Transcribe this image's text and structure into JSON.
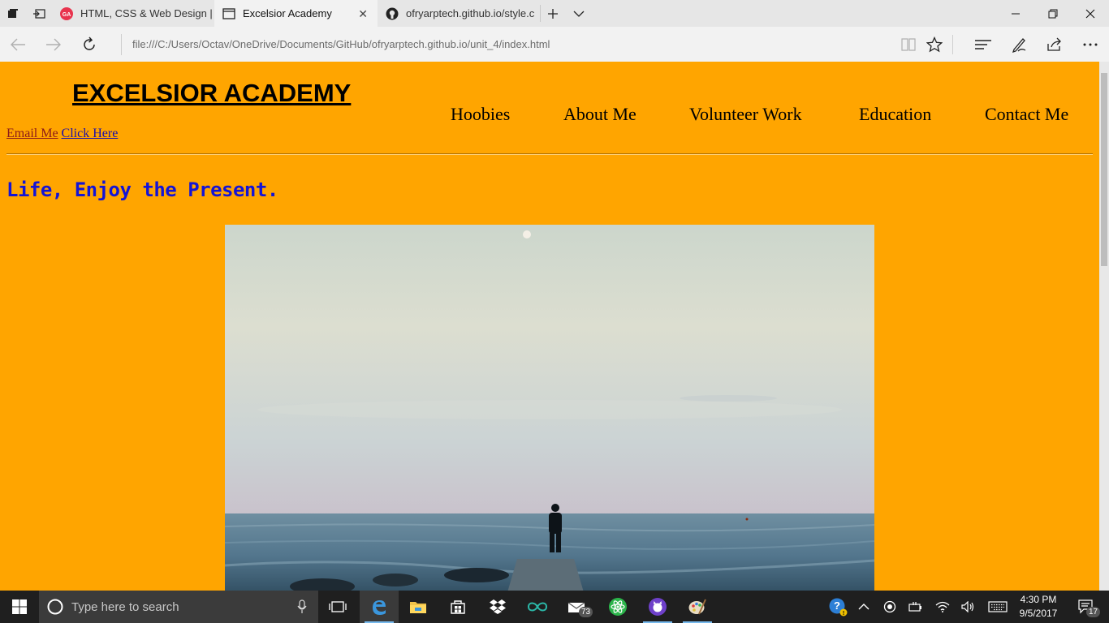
{
  "browser": {
    "tabs": [
      {
        "title": "HTML, CSS & Web Design |",
        "favicon": "ga-logo-icon",
        "active": false
      },
      {
        "title": "Excelsior Academy",
        "favicon": "page-icon",
        "active": true
      },
      {
        "title": "ofryarptech.github.io/style.c",
        "favicon": "github-icon",
        "active": false
      }
    ],
    "address": "file:///C:/Users/Octav/OneDrive/Documents/GitHub/ofryarptech.github.io/unit_4/index.html"
  },
  "page": {
    "title": "EXCELSIOR ACADEMY",
    "links": [
      {
        "label": "Email Me"
      },
      {
        "label": "Click Here"
      }
    ],
    "nav": [
      "Hoobies",
      "About Me",
      "Volunteer Work",
      "Education",
      "Contact Me"
    ],
    "tagline": "Life, Enjoy the Present.",
    "colors": {
      "background": "#ffa500",
      "tagline": "#1414d6",
      "link": "#1a0dab",
      "visited_link": "#8b1a1a"
    }
  },
  "taskbar": {
    "search_placeholder": "Type here to search",
    "mail_badge": "73",
    "time": "4:30 PM",
    "date": "9/5/2017",
    "notification_count": "17"
  }
}
